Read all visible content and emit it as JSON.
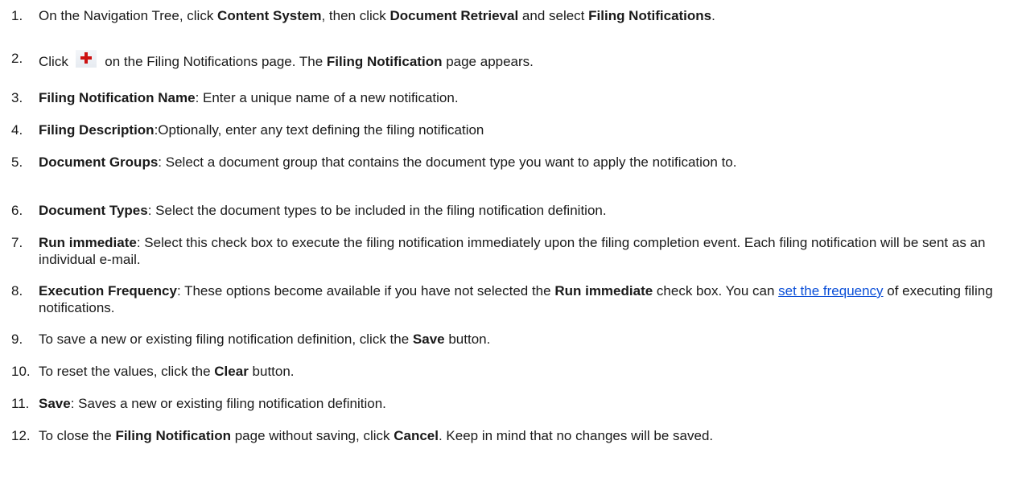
{
  "steps": [
    {
      "number": "1.",
      "parts": [
        {
          "t": "On the Navigation Tree, click "
        },
        {
          "t": "Content System",
          "b": true
        },
        {
          "t": ", then click "
        },
        {
          "t": "Document Retrieval",
          "b": true
        },
        {
          "t": " and select "
        },
        {
          "t": "Filing Notifications",
          "b": true
        },
        {
          "t": "."
        }
      ]
    },
    {
      "number": "2.",
      "parts": [
        {
          "t": "Click "
        },
        {
          "icon": "plus-icon"
        },
        {
          "t": " on the Filing Notifications page. The "
        },
        {
          "t": "Filing Notification",
          "b": true
        },
        {
          "t": " page appears."
        }
      ]
    },
    {
      "number": "3.",
      "parts": [
        {
          "t": "Filing Notification Name",
          "b": true
        },
        {
          "t": ": Enter a unique name of a new notification."
        }
      ]
    },
    {
      "number": "4.",
      "parts": [
        {
          "t": "Filing Description",
          "b": true
        },
        {
          "t": ":Optionally, enter any text defining the filing notification"
        }
      ]
    },
    {
      "number": "5.",
      "parts": [
        {
          "t": "Document Groups",
          "b": true
        },
        {
          "t": ": Select a document group that contains the document type you want to apply the notification to."
        }
      ]
    },
    {
      "number": "6.",
      "parts": [
        {
          "t": "Document Types",
          "b": true
        },
        {
          "t": ": Select the document types to be included in the filing notification definition."
        }
      ]
    },
    {
      "number": "7.",
      "parts": [
        {
          "t": "Run immediate",
          "b": true
        },
        {
          "t": ": Select this check box to execute the filing notification immediately upon the filing completion event. Each filing notification will be sent as an individual e-mail."
        }
      ]
    },
    {
      "number": "8.",
      "parts": [
        {
          "t": "Execution Frequency",
          "b": true
        },
        {
          "t": ": These options become available if you have not selected the "
        },
        {
          "t": "Run immediate",
          "b": true
        },
        {
          "t": " check box. You can "
        },
        {
          "t": "set the frequency",
          "link": true
        },
        {
          "t": " of executing filing notifications."
        }
      ]
    },
    {
      "number": "9.",
      "parts": [
        {
          "t": "To save a new or existing filing notification definition, click the "
        },
        {
          "t": "Save",
          "b": true
        },
        {
          "t": " button."
        }
      ]
    },
    {
      "number": "10.",
      "parts": [
        {
          "t": "To reset the values, click the "
        },
        {
          "t": "Clear",
          "b": true
        },
        {
          "t": " button."
        }
      ]
    },
    {
      "number": "11.",
      "parts": [
        {
          "t": "Save",
          "b": true
        },
        {
          "t": ": Saves a new or existing filing notification definition."
        }
      ]
    },
    {
      "number": "12.",
      "parts": [
        {
          "t": "To close the "
        },
        {
          "t": "Filing Notification",
          "b": true
        },
        {
          "t": " page without saving, click "
        },
        {
          "t": "Cancel",
          "b": true
        },
        {
          "t": ". Keep in mind that no changes will be saved."
        }
      ]
    }
  ],
  "colors": {
    "text": "#1a1a1a",
    "link": "#0b4fd8",
    "icon_plus": "#cc1111"
  }
}
